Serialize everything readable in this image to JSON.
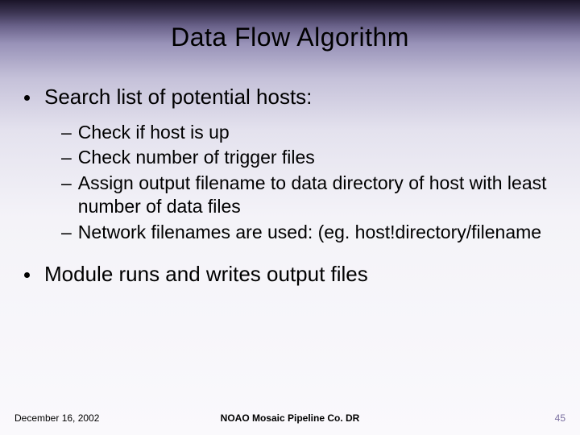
{
  "title": "Data Flow Algorithm",
  "bullets": {
    "b1": "Search list of potential hosts:",
    "b1_subs": {
      "s1": "Check if host is up",
      "s2": "Check number of trigger files",
      "s3": "Assign output filename to data directory of host with least number of data files",
      "s4": "Network filenames are used: (eg. host!directory/filename"
    },
    "b2": "Module runs and writes output files"
  },
  "footer": {
    "date": "December 16, 2002",
    "center": "NOAO Mosaic Pipeline Co. DR",
    "page": "45"
  }
}
